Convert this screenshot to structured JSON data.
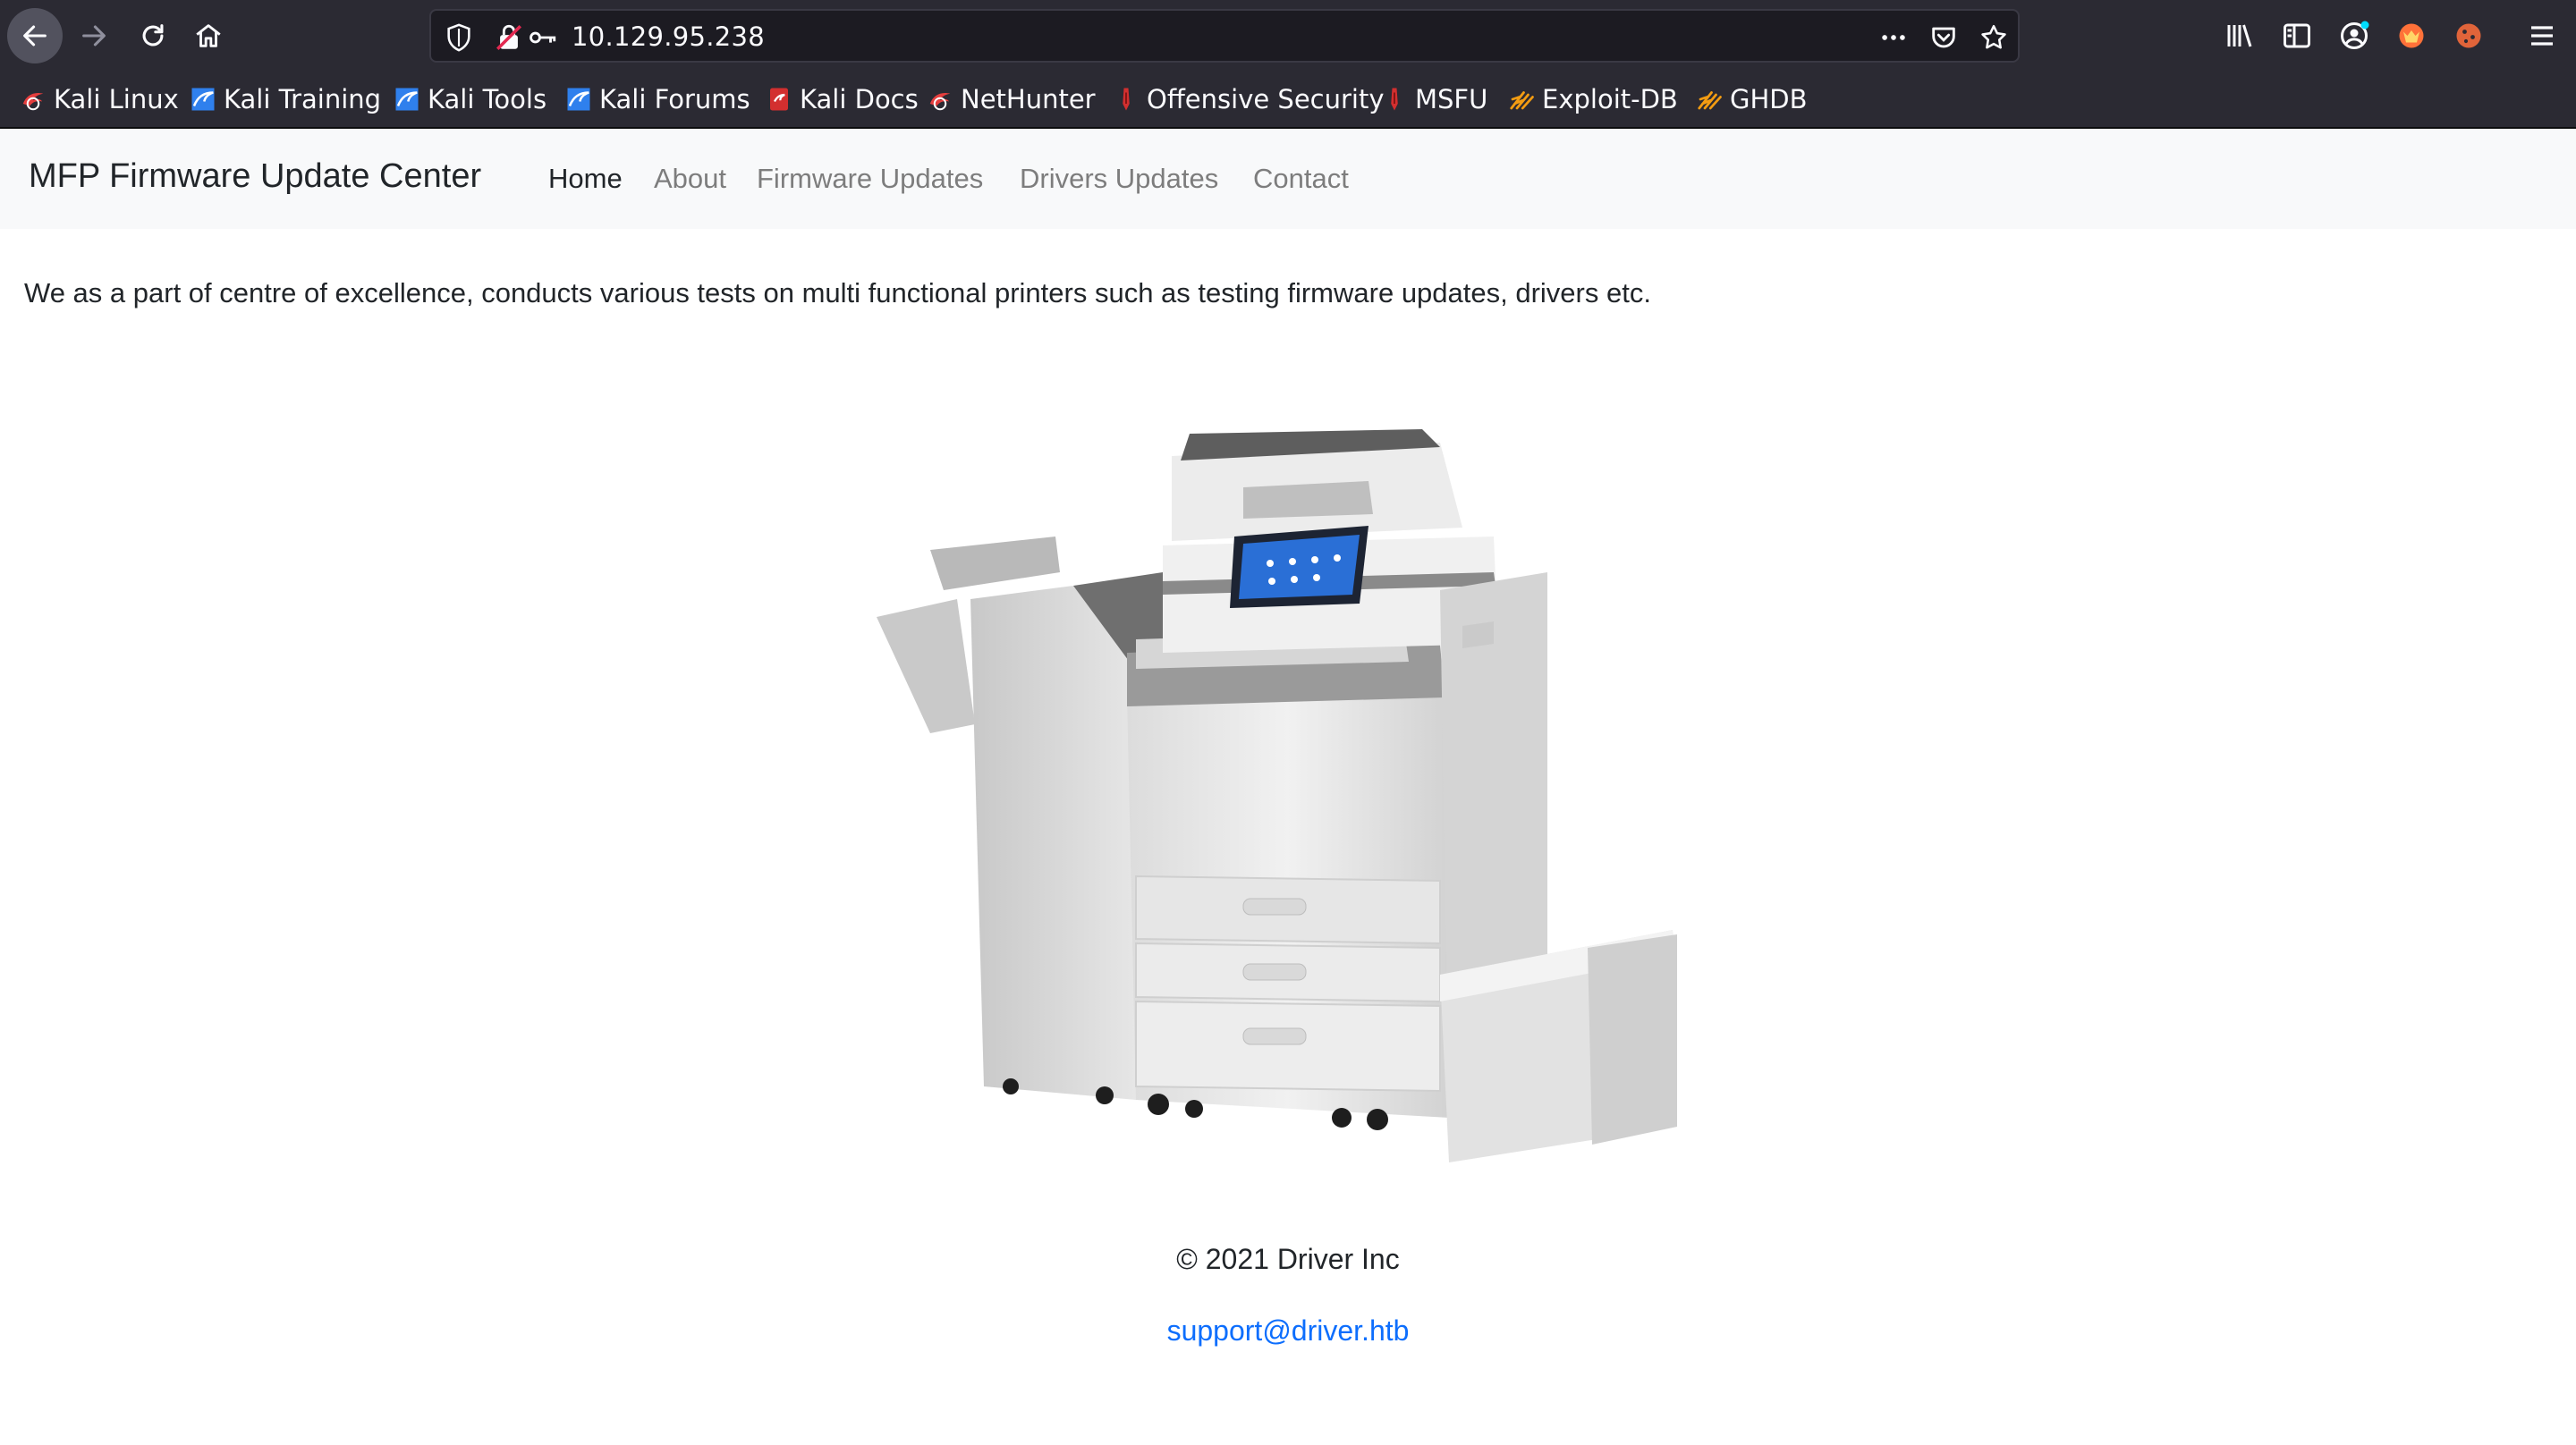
{
  "browser": {
    "url": "10.129.95.238",
    "bookmarks": [
      {
        "label": "Kali Linux",
        "icon": "kali-dragon-red-icon"
      },
      {
        "label": "Kali Training",
        "icon": "kali-dragon-blue-icon"
      },
      {
        "label": "Kali Tools",
        "icon": "kali-dragon-blue-icon"
      },
      {
        "label": "Kali Forums",
        "icon": "kali-dragon-blue-icon"
      },
      {
        "label": "Kali Docs",
        "icon": "kali-docs-red-icon"
      },
      {
        "label": "NetHunter",
        "icon": "kali-dragon-red-icon"
      },
      {
        "label": "Offensive Security",
        "icon": "offsec-red-icon"
      },
      {
        "label": "MSFU",
        "icon": "offsec-red-icon"
      },
      {
        "label": "Exploit-DB",
        "icon": "exploitdb-orange-icon"
      },
      {
        "label": "GHDB",
        "icon": "exploitdb-orange-icon"
      }
    ]
  },
  "site": {
    "brand": "MFP Firmware Update Center",
    "nav": [
      {
        "label": "Home",
        "active": true
      },
      {
        "label": "About",
        "active": false
      },
      {
        "label": "Firmware Updates",
        "active": false
      },
      {
        "label": "Drivers Updates",
        "active": false
      },
      {
        "label": "Contact",
        "active": false
      }
    ],
    "intro": "We as a part of centre of excellence, conducts various tests on multi functional printers such as testing firmware updates, drivers etc.",
    "image": "multifunction-printer-image",
    "footer": {
      "copyright": "© 2021 Driver Inc",
      "email": "support@driver.htb"
    }
  },
  "colors": {
    "chrome": "#2b2a33",
    "urlbar": "#1c1b22",
    "navbar": "#f8f9fa",
    "link": "#0d6efd"
  }
}
